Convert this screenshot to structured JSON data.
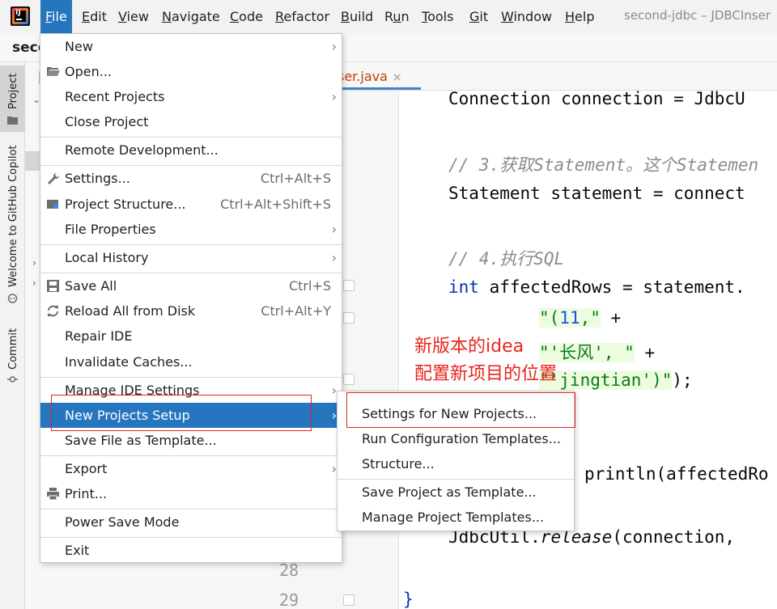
{
  "menubar": {
    "items": [
      {
        "label": "File",
        "underline": "F"
      },
      {
        "label": "Edit",
        "underline": "E"
      },
      {
        "label": "View",
        "underline": "V"
      },
      {
        "label": "Navigate",
        "underline": "N"
      },
      {
        "label": "Code",
        "underline": "C"
      },
      {
        "label": "Refactor",
        "underline": "R"
      },
      {
        "label": "Build",
        "underline": "B"
      },
      {
        "label": "Run",
        "underline": "u"
      },
      {
        "label": "Tools",
        "underline": "T"
      },
      {
        "label": "Git",
        "underline": "G"
      },
      {
        "label": "Window",
        "underline": "W"
      },
      {
        "label": "Help",
        "underline": "H"
      }
    ],
    "window_title": "second-jdbc – JDBCInser"
  },
  "project": {
    "name": "seco"
  },
  "tool_strip": {
    "project_label": "Project",
    "copilot_label": "Welcome to GitHub Copilot",
    "commit_label": "Commit"
  },
  "editor": {
    "tab_label": "ser.java",
    "line_numbers": [
      "28",
      "29"
    ],
    "code": {
      "l1": "Connection connection = JdbcU",
      "l2_comment": "// 3.获取Statement。这个Statemen",
      "l3": "Statement statement = connect",
      "l4_comment": "// 4.执行SQL",
      "l5_kw": "int",
      "l5_rest": " affectedRows = statement.",
      "l6_str1": "\"(",
      "l6_num": "11",
      "l6_str2": ",\"",
      "l6_plus": " +",
      "l7_str": "\"'长风', \"",
      "l7_plus": " +",
      "l8_str": "\"'jingtian')\"",
      "l8_end": ");",
      "l9": "println(affectedRo",
      "l10_a": "JdbcUtil.",
      "l10_b": "release",
      "l10_c": "(connection,",
      "l11": "}"
    }
  },
  "annotation": {
    "line1": "新版本的idea",
    "line2": "配置新项目的位置"
  },
  "file_menu": {
    "new": "New",
    "open": "Open...",
    "recent": "Recent Projects",
    "close": "Close Project",
    "remote": "Remote Development...",
    "settings": "Settings...",
    "settings_sc": "Ctrl+Alt+S",
    "structure": "Project Structure...",
    "structure_sc": "Ctrl+Alt+Shift+S",
    "file_props": "File Properties",
    "local_history": "Local History",
    "save_all": "Save All",
    "save_all_sc": "Ctrl+S",
    "reload": "Reload All from Disk",
    "reload_sc": "Ctrl+Alt+Y",
    "repair": "Repair IDE",
    "invalidate": "Invalidate Caches...",
    "manage_ide": "Manage IDE Settings",
    "new_projects_setup": "New Projects Setup",
    "save_template": "Save File as Template...",
    "export": "Export",
    "print": "Print...",
    "power_save": "Power Save Mode",
    "exit": "Exit"
  },
  "sub_menu": {
    "settings_new": "Settings for New Projects...",
    "run_config": "Run Configuration Templates...",
    "structure": "Structure...",
    "save_as_template": "Save Project as Template...",
    "manage_templates": "Manage Project Templates..."
  },
  "colors": {
    "accent": "#2675bf",
    "annotation_red": "#e8241c"
  }
}
